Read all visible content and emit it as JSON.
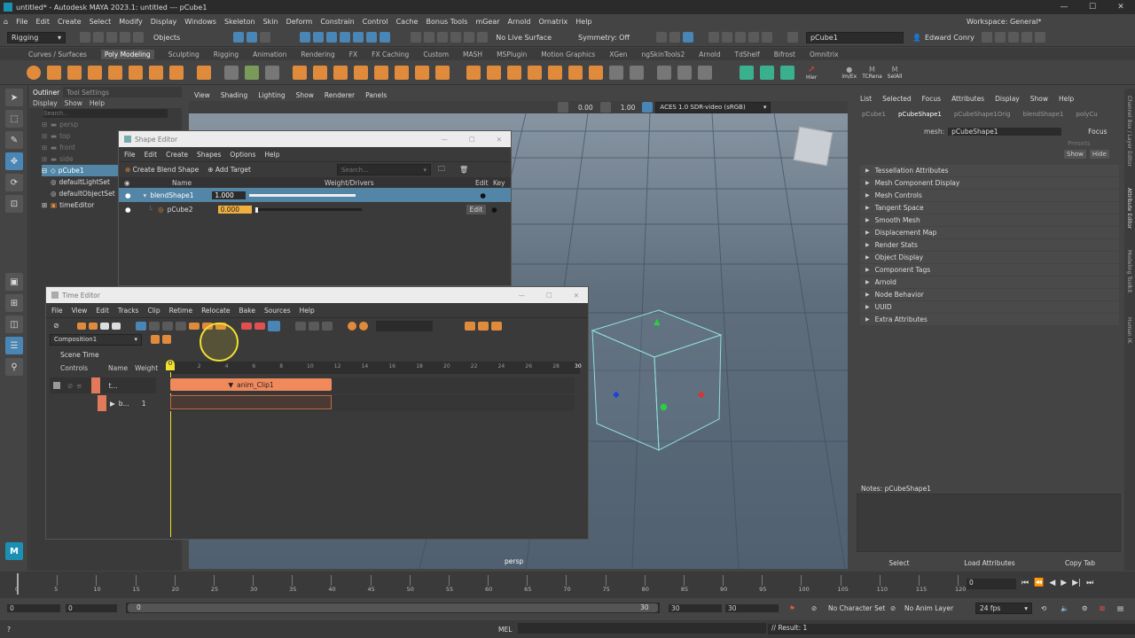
{
  "title": "untitled* - Autodesk MAYA 2023.1: untitled   ---   pCube1",
  "menus": [
    "File",
    "Edit",
    "Create",
    "Select",
    "Modify",
    "Display",
    "Windows",
    "Skeleton",
    "Skin",
    "Deform",
    "Constrain",
    "Control",
    "Cache",
    "Bonus Tools",
    "mGear",
    "Arnold",
    "Ornatrix",
    "Help"
  ],
  "workspace_label": "Workspace: General*",
  "status": {
    "mode": "Rigging",
    "objects": "Objects",
    "live_surface": "No Live Surface",
    "symmetry": "Symmetry: Off",
    "object_name": "pCube1",
    "user": "Edward Conry"
  },
  "shelf_tabs": [
    "Curves / Surfaces",
    "Poly Modeling",
    "Sculpting",
    "Rigging",
    "Animation",
    "Rendering",
    "FX",
    "FX Caching",
    "Custom",
    "MASH",
    "MSPlugin",
    "Motion Graphics",
    "XGen",
    "ngSkinTools2",
    "Arnold",
    "TdShelf",
    "Bifrost",
    "Omnitrix"
  ],
  "shelf_active": "Poly Modeling",
  "shelf_right_labels": [
    "Hier",
    "im/Ex",
    "TCRena",
    "SelAll"
  ],
  "outliner": {
    "tabs": [
      "Outliner",
      "Tool Settings"
    ],
    "menu": [
      "Display",
      "Show",
      "Help"
    ],
    "search_placeholder": "Search...",
    "items": [
      "persp",
      "top",
      "front",
      "side",
      "pCube1",
      "defaultLightSet",
      "defaultObjectSet",
      "timeEditor"
    ]
  },
  "viewport": {
    "menu": [
      "View",
      "Shading",
      "Lighting",
      "Show",
      "Renderer",
      "Panels"
    ],
    "val1": "0.00",
    "val2": "1.00",
    "colorspace": "ACES 1.0 SDR-video (sRGB)",
    "camera": "persp"
  },
  "shape_editor": {
    "title": "Shape Editor",
    "menu": [
      "File",
      "Edit",
      "Create",
      "Shapes",
      "Options",
      "Help"
    ],
    "create_btn": "Create Blend Shape",
    "add_target": "Add Target",
    "search": "Search...",
    "headers": {
      "name": "Name",
      "weight": "Weight/Drivers",
      "edit": "Edit",
      "key": "Key"
    },
    "rows": [
      {
        "name": "blendShape1",
        "value": "1.000",
        "fill": 1.0
      },
      {
        "name": "pCube2",
        "value": "0.000",
        "fill": 0.0,
        "edit": "Edit"
      }
    ]
  },
  "time_editor": {
    "title": "Time Editor",
    "menu": [
      "File",
      "View",
      "Edit",
      "Tracks",
      "Clip",
      "Retime",
      "Relocate",
      "Bake",
      "Sources",
      "Help"
    ],
    "composition": "Composition1",
    "scene_time": "Scene Time",
    "headers": {
      "controls": "Controls",
      "name": "Name",
      "weight": "Weight"
    },
    "track1_name": "t...",
    "track2_name": "b...",
    "track2_num": "1",
    "ruler": [
      "0",
      "2",
      "4",
      "6",
      "8",
      "10",
      "12",
      "14",
      "16",
      "18",
      "20",
      "22",
      "24",
      "26",
      "28",
      "30"
    ],
    "current": "0",
    "clip_label": "anim_Clip1"
  },
  "attr_editor": {
    "tabs": [
      "List",
      "Selected",
      "Focus",
      "Attributes",
      "Display",
      "Show",
      "Help"
    ],
    "node_tabs": [
      "pCube1",
      "pCubeShape1",
      "pCubeShape1Orig",
      "blendShape1",
      "polyCu"
    ],
    "mesh_label": "mesh:",
    "mesh_value": "pCubeShape1",
    "focus": "Focus",
    "presets": "Presets",
    "show": "Show",
    "hide": "Hide",
    "sections": [
      "Tessellation Attributes",
      "Mesh Component Display",
      "Mesh Controls",
      "Tangent Space",
      "Smooth Mesh",
      "Displacement Map",
      "Render Stats",
      "Object Display",
      "Component Tags",
      "Arnold",
      "Node Behavior",
      "UUID",
      "Extra Attributes"
    ],
    "notes": "Notes:  pCubeShape1",
    "buttons": [
      "Select",
      "Load Attributes",
      "Copy Tab"
    ]
  },
  "side_labels": [
    "Channel Box / Layer Editor",
    "Attribute Editor",
    "Modeling Toolkit",
    "Human IK"
  ],
  "timeline": {
    "ticks": [
      "0",
      "5",
      "10",
      "15",
      "20",
      "25",
      "30",
      "35",
      "40",
      "45",
      "50",
      "55",
      "60",
      "65",
      "70",
      "75",
      "80",
      "85",
      "90",
      "95",
      "100",
      "105",
      "110",
      "115",
      "120"
    ],
    "current_frame": "0"
  },
  "range": {
    "start": "0",
    "start2": "0",
    "slider_start": "0",
    "slider_end": "30",
    "end": "30",
    "end2": "30",
    "char_set": "No Character Set",
    "anim_layer": "No Anim Layer",
    "fps": "24 fps"
  },
  "cmd": {
    "lang": "MEL",
    "result": "// Result: 1"
  }
}
